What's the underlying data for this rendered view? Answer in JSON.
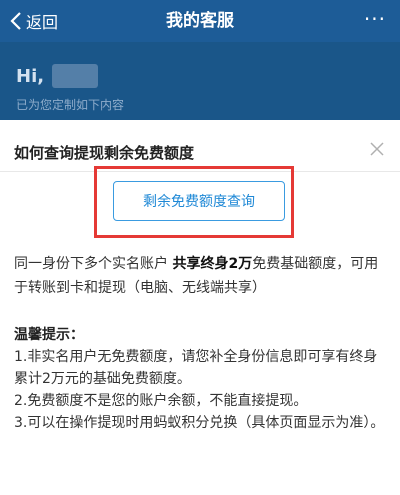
{
  "nav": {
    "back_label": "返回",
    "title": "我的客服",
    "more_label": "···"
  },
  "hero": {
    "greeting": "Hi,",
    "subtitle": "已为您定制如下内容"
  },
  "card": {
    "title": "如何查询提现剩余免费额度",
    "query_button_label": "剩余免费额度查询",
    "desc_part1": "同一身份下多个实名账户 ",
    "desc_bold": "共享终身2万",
    "desc_part2": "免费基础额度，可用于转账到卡和提现（电脑、无线端共享）",
    "tips_title": "温馨提示：",
    "tips": [
      "1.非实名用户无免费额度，请您补全身份信息即可享有终身累计2万元的基础免费额度。",
      "2.免费额度不是您的账户余额，不能直接提现。",
      "3.可以在操作提现时用蚂蚁积分兑换（具体页面显示为准）。"
    ]
  },
  "colors": {
    "nav_bg": "#1d5c97",
    "accent": "#1e88d6",
    "highlight": "#e53935"
  }
}
